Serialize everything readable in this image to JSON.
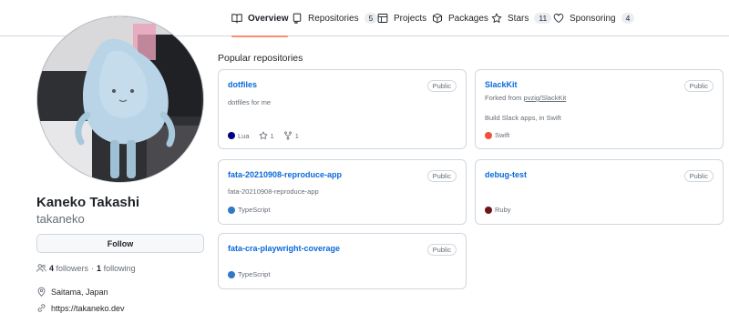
{
  "nav": {
    "tabs": [
      {
        "label": "Overview",
        "icon": "book-icon"
      },
      {
        "label": "Repositories",
        "count": "5",
        "icon": "repo-icon"
      },
      {
        "label": "Projects",
        "icon": "table-icon"
      },
      {
        "label": "Packages",
        "icon": "package-icon"
      },
      {
        "label": "Stars",
        "count": "11",
        "icon": "star-icon"
      },
      {
        "label": "Sponsoring",
        "count": "4",
        "icon": "heart-icon"
      }
    ]
  },
  "profile": {
    "name": "Kaneko Takashi",
    "login": "takaneko",
    "follow_label": "Follow",
    "followers_count": "4",
    "followers_label": "followers",
    "separator": "·",
    "following_count": "1",
    "following_label": "following",
    "location": "Saitama, Japan",
    "website": "https://takaneko.dev"
  },
  "popular": {
    "title": "Popular repositories",
    "repos": [
      {
        "name": "dotfiles",
        "visibility": "Public",
        "description": "dotfiles for me",
        "language": "Lua",
        "language_color": "#000080",
        "stars": "1",
        "forks": "1"
      },
      {
        "name": "SlackKit",
        "visibility": "Public",
        "forked_prefix": "Forked from",
        "forked_from": "pvzig/SlackKit",
        "description": "Build Slack apps, in Swift",
        "language": "Swift",
        "language_color": "#F05138"
      },
      {
        "name": "fata-20210908-reproduce-app",
        "visibility": "Public",
        "description": "fata-20210908-reproduce-app",
        "language": "TypeScript",
        "language_color": "#3178c6"
      },
      {
        "name": "debug-test",
        "visibility": "Public",
        "language": "Ruby",
        "language_color": "#701516"
      },
      {
        "name": "fata-cra-playwright-coverage",
        "visibility": "Public",
        "language": "TypeScript",
        "language_color": "#3178c6"
      }
    ]
  },
  "colors": {
    "accent_underline": "#fd8c73",
    "link": "#0969da",
    "border": "#d0d7de"
  }
}
